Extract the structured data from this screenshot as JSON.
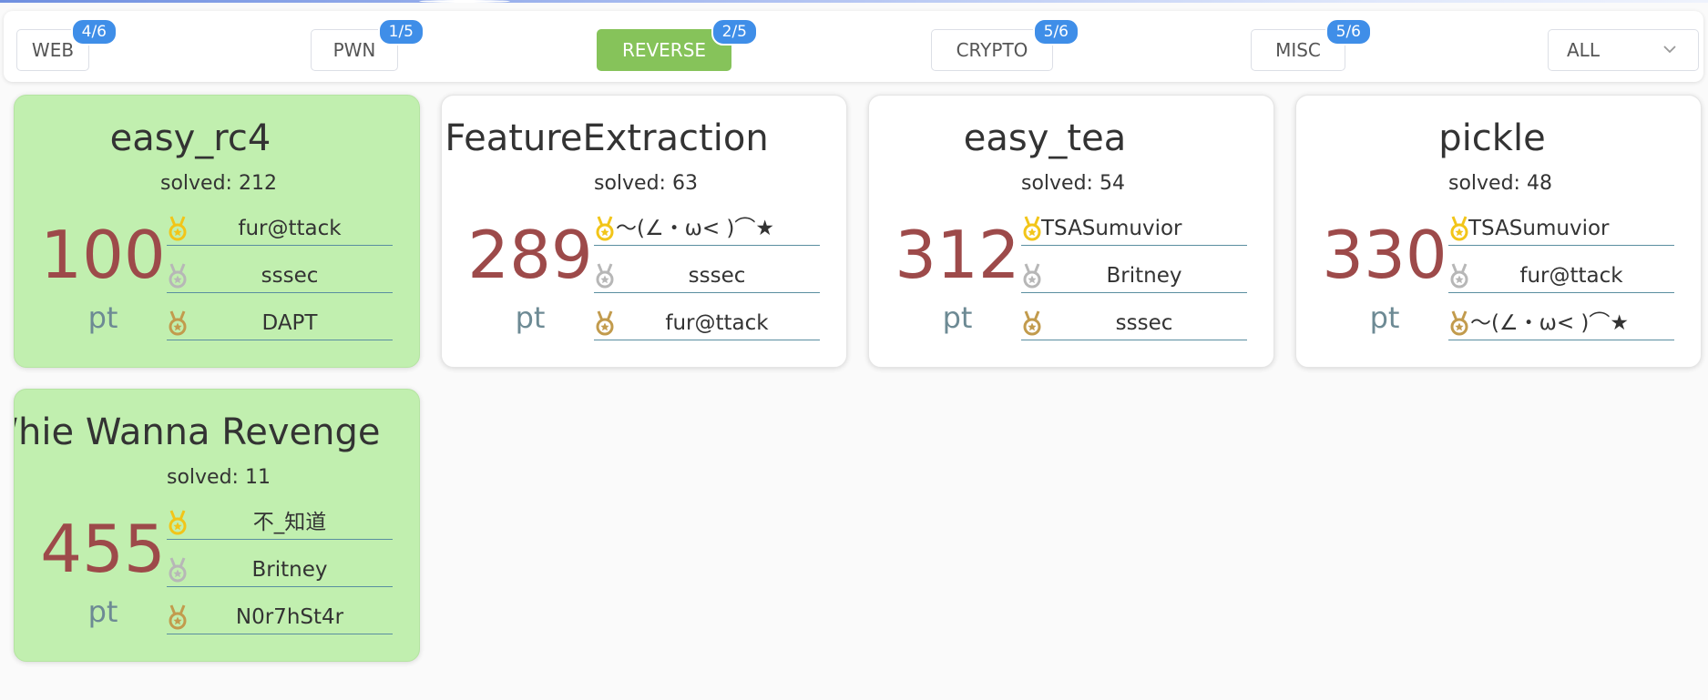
{
  "tabs": [
    {
      "label": "WEB",
      "count": "4/6",
      "active": false
    },
    {
      "label": "PWN",
      "count": "1/5",
      "active": false
    },
    {
      "label": "REVERSE",
      "count": "2/5",
      "active": true
    },
    {
      "label": "CRYPTO",
      "count": "5/6",
      "active": false
    },
    {
      "label": "MISC",
      "count": "5/6",
      "active": false
    }
  ],
  "filter": {
    "selected": "ALL"
  },
  "colors": {
    "accent_green": "#86c35a",
    "solved_card": "#c1efaf",
    "badge_blue": "#3f8ee8",
    "score_red": "#9d4a4a",
    "gold": "#f2c519",
    "silver": "#b7b7b7",
    "bronze": "#c29b4d"
  },
  "challenges": [
    {
      "title": "easy_rc4",
      "solved_label": "solved: 212",
      "score": "100",
      "unit": "pt",
      "solved_by_me": true,
      "bloods": [
        "fur@ttack",
        "sssec",
        "DAPT"
      ]
    },
    {
      "title": "FeatureExtraction",
      "solved_label": "solved: 63",
      "score": "289",
      "unit": "pt",
      "solved_by_me": false,
      "bloods": [
        "～(∠・ω< )⌒★",
        "sssec",
        "fur@ttack"
      ]
    },
    {
      "title": "easy_tea",
      "solved_label": "solved: 54",
      "score": "312",
      "unit": "pt",
      "solved_by_me": false,
      "bloods": [
        "TSASumuvior",
        "Britney",
        "sssec"
      ]
    },
    {
      "title": "pickle",
      "solved_label": "solved: 48",
      "score": "330",
      "unit": "pt",
      "solved_by_me": false,
      "bloods": [
        "TSASumuvior",
        "fur@ttack",
        "～(∠・ω< )⌒★"
      ]
    },
    {
      "title": "Whie Wanna Revenge",
      "solved_label": "solved: 11",
      "score": "455",
      "unit": "pt",
      "solved_by_me": true,
      "bloods": [
        "不_知道",
        "Britney",
        "N0r7hSt4r"
      ]
    }
  ],
  "icons": {
    "medal_first": "gold-medal-icon",
    "medal_second": "silver-medal-icon",
    "medal_third": "bronze-medal-icon",
    "dropdown": "chevron-down-icon"
  }
}
